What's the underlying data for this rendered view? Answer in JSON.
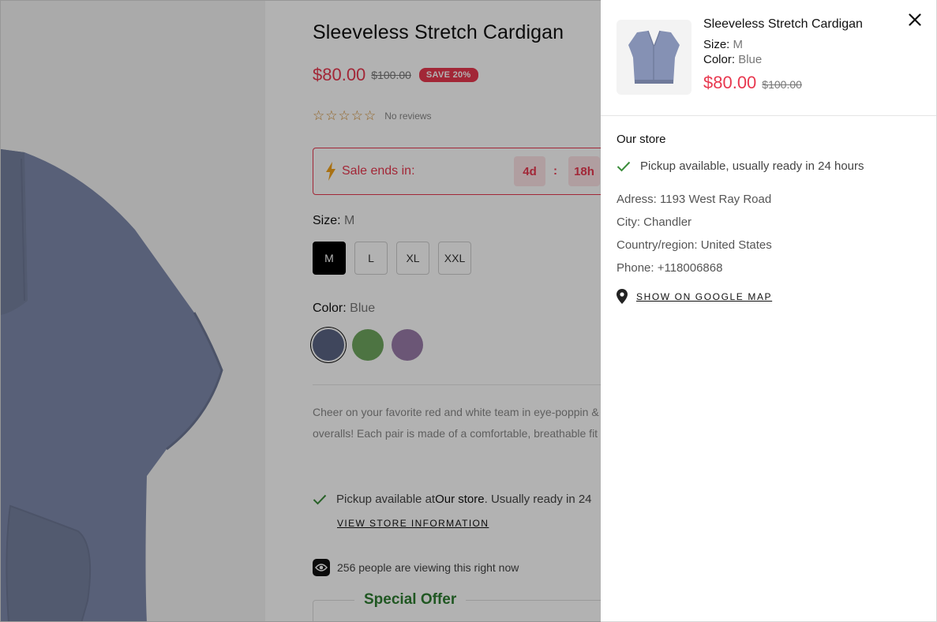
{
  "product": {
    "title": "Sleeveless Stretch Cardigan",
    "price": "$80.00",
    "compare_price": "$100.00",
    "save_badge": "SAVE 20%",
    "rating_stars": "☆☆☆☆☆",
    "reviews_text": "No reviews",
    "sale": {
      "label": "Sale ends in:",
      "countdown": [
        "4d",
        "18h"
      ],
      "separator": ":"
    },
    "size": {
      "label": "Size:",
      "selected": "M",
      "options": [
        "M",
        "L",
        "XL",
        "XXL"
      ]
    },
    "color": {
      "label": "Color:",
      "selected": "Blue",
      "swatches": [
        "#5b6584",
        "#6fa65f",
        "#9a7ca9"
      ]
    },
    "description": "Cheer on your favorite red and white team in eye-poppin & white striped game bib overalls! Each pair is made of a comfortable, breathable fit regardless of the weather ar",
    "pickup": {
      "prefix": "Pickup available at ",
      "store": "Our store",
      "suffix": ". Usually ready in 24",
      "link": "VIEW STORE INFORMATION"
    },
    "viewers_text": "256 people are viewing this right now",
    "special_offer": "Special Offer"
  },
  "drawer": {
    "name": "Sleeveless Stretch Cardigan",
    "size_label": "Size:",
    "size_value": "M",
    "color_label": "Color:",
    "color_value": "Blue",
    "price": "$80.00",
    "compare_price": "$100.00",
    "store_name": "Our store",
    "pickup_text": "Pickup available, usually ready in 24 hours",
    "address": "Adress: 1193 West Ray Road",
    "city": "City: Chandler",
    "country": "Country/region: United States",
    "phone": "Phone: +118006868",
    "map_link": "SHOW ON GOOGLE MAP"
  },
  "colors": {
    "sale_red": "#e8384f",
    "offer_green": "#2e7d32",
    "check_green": "#3b8d3b",
    "cardigan_blue": "#5b6584"
  },
  "icons": [
    "bolt-icon",
    "check-icon",
    "eye-icon",
    "close-icon",
    "map-pin-icon"
  ]
}
